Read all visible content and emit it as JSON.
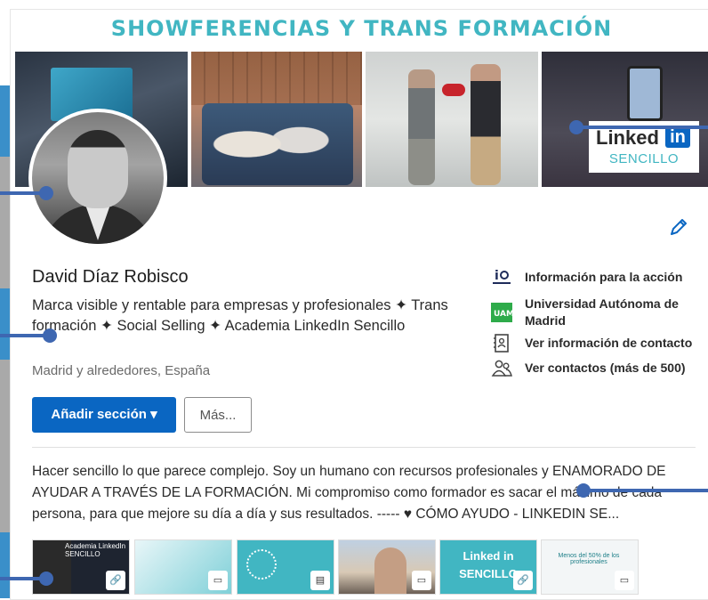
{
  "cover": {
    "title": "SHOWFERENCIAS Y TRANS FORMACIÓN",
    "badge_word": "Linked",
    "badge_in": "in",
    "badge_sub": "SENCILLO"
  },
  "profile": {
    "name": "David Díaz Robisco",
    "headline": "Marca visible y rentable para empresas y profesionales ✦ Trans formación ✦ Social Selling ✦ Academia LinkedIn Sencillo",
    "location": "Madrid y alrededores, España"
  },
  "actions": {
    "add_section": "Añadir sección ▾",
    "more": "Más..."
  },
  "side": {
    "items": [
      {
        "label": "Información para la acción",
        "icon": "company-logo-icon"
      },
      {
        "label": "Universidad Autónoma de Madrid",
        "icon": "university-logo-icon"
      },
      {
        "label": "Ver información de contacto",
        "icon": "contact-card-icon"
      },
      {
        "label": "Ver contactos (más de 500)",
        "icon": "people-icon"
      }
    ]
  },
  "about": {
    "text": "Hacer sencillo lo que parece complejo. Soy un humano con recursos profesionales y ENAMORADO DE AYUDAR A TRAVÉS DE LA FORMACIÓN. Mi compromiso como formador es sacar el máximo de cada persona, para que mejore su día a día y sus resultados. ----- ♥ CÓMO AYUDO - LINKEDIN SE..."
  },
  "media": {
    "items": [
      {
        "kind": "link-icon",
        "caption": "Academia LinkedIn SENCILLO"
      },
      {
        "kind": "video-icon",
        "caption": ""
      },
      {
        "kind": "document-icon",
        "caption": ""
      },
      {
        "kind": "video-icon",
        "caption": ""
      },
      {
        "kind": "link-icon",
        "caption": "Linked in SENCILLO"
      },
      {
        "kind": "video-icon",
        "caption": "Menos del 50% de los profesionales"
      }
    ]
  },
  "colors": {
    "accent": "#0a66c2",
    "brand_teal": "#41b6c2",
    "annotation": "#3e67b1"
  }
}
